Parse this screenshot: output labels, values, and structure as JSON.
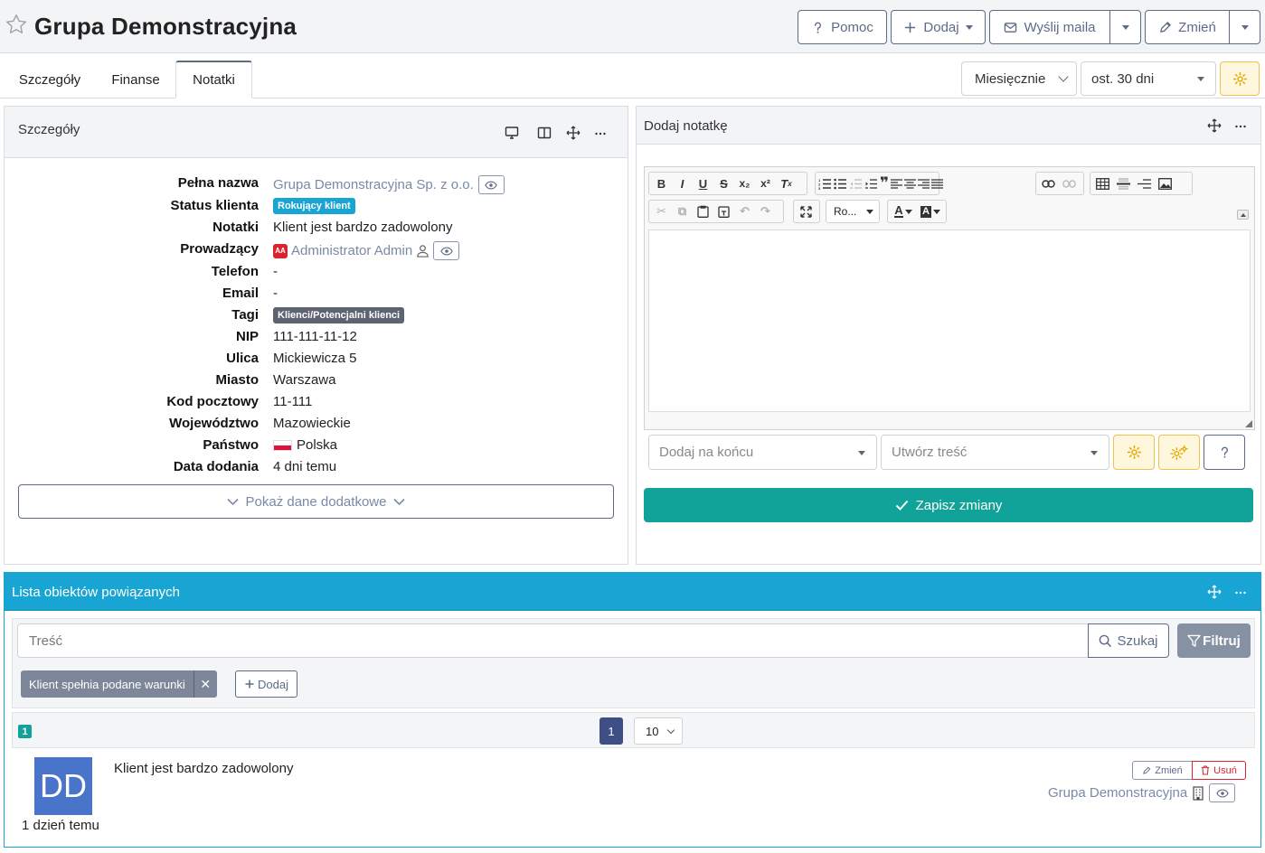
{
  "header": {
    "title": "Grupa Demonstracyjna",
    "btn_help": "Pomoc",
    "btn_add": "Dodaj",
    "btn_mail": "Wyślij maila",
    "btn_edit": "Zmień"
  },
  "tabs": [
    {
      "label": "Szczegóły"
    },
    {
      "label": "Finanse"
    },
    {
      "label": "Notatki"
    }
  ],
  "filters": {
    "period": "Miesięcznie",
    "range": "ost. 30 dni"
  },
  "details_panel": {
    "title": "Szczegóły",
    "rows": [
      {
        "label": "Pełna nazwa",
        "value": "Grupa Demonstracyjna Sp. z o.o."
      },
      {
        "label": "Status klienta",
        "value": "Rokujący klient"
      },
      {
        "label": "Notatki",
        "value": "Klient jest bardzo zadowolony"
      },
      {
        "label": "Prowadzący",
        "value": "Administrator Admin",
        "avatar": "AA"
      },
      {
        "label": "Telefon",
        "value": "-"
      },
      {
        "label": "Email",
        "value": "-"
      },
      {
        "label": "Tagi",
        "value": "Klienci/Potencjalni klienci"
      },
      {
        "label": "NIP",
        "value": "111-111-11-12"
      },
      {
        "label": "Ulica",
        "value": "Mickiewicza 5"
      },
      {
        "label": "Miasto",
        "value": "Warszawa"
      },
      {
        "label": "Kod pocztowy",
        "value": "11-111"
      },
      {
        "label": "Województwo",
        "value": "Mazowieckie"
      },
      {
        "label": "Państwo",
        "value": "Polska"
      },
      {
        "label": "Data dodania",
        "value": "4 dni temu"
      }
    ],
    "show_more": "Pokaż dane dodatkowe",
    "colors": {
      "status_badge": "#19a5d4",
      "tag_badge": "#5d6470",
      "avatar": "#d9232d"
    }
  },
  "note_panel": {
    "title": "Dodaj notatkę",
    "font_select": "Ro...",
    "position_select": "Dodaj na końcu",
    "content_select": "Utwórz treść",
    "save": "Zapisz zmiany",
    "colors": {
      "save_bg": "#11a39a"
    }
  },
  "related_panel": {
    "title": "Lista obiektów powiązanych",
    "search_placeholder": "Treść",
    "search_btn": "Szukaj",
    "filter_btn": "Filtruj",
    "filter_chip": "Klient spełnia podane warunki",
    "add_filter": "Dodaj",
    "count": "1",
    "page": "1",
    "per_page": "10",
    "items": [
      {
        "initials": "DD",
        "time": "1 dzień temu",
        "text": "Klient jest bardzo zadowolony",
        "edit": "Zmień",
        "delete": "Usuń",
        "link": "Grupa Demonstracyjna"
      }
    ],
    "colors": {
      "head_bg": "#19a5d4",
      "avatar_bg": "#4a74c9",
      "page_active": "#3d4f84"
    }
  }
}
